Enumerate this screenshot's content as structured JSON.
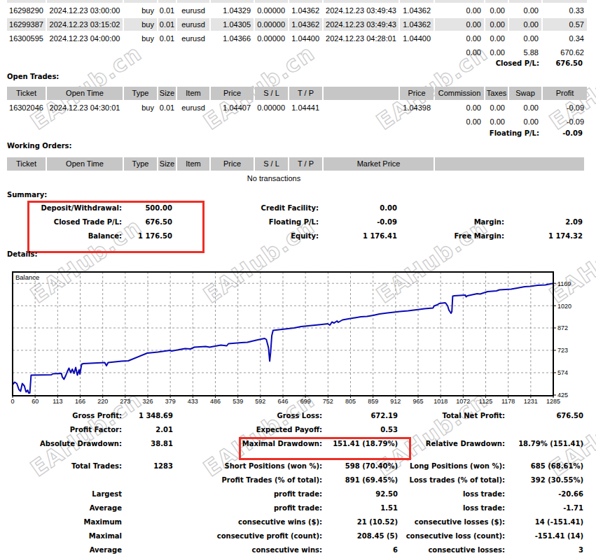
{
  "watermark": {
    "text": "EAHub.cn",
    "color": "#cccccc"
  },
  "colors": {
    "annotation_red": "#ee2e26",
    "curve_blue": "#0a0ab4",
    "table_header_bg": "#c6c6c6",
    "table_alt_row_bg": "#e4e4e4",
    "grid_gray": "#9a9a9a"
  },
  "closed_trades": {
    "rows": [
      [
        "16298290",
        "2024.12.23 03:00:00",
        "buy",
        "0.01",
        "eurusd",
        "1.04329",
        "0.00000",
        "1.04362",
        "2024.12.23 03:49:43",
        "1.04362",
        "0.00",
        "0.00",
        "0.00",
        "0.33"
      ],
      [
        "16299387",
        "2024.12.23 03:15:02",
        "buy",
        "0.01",
        "eurusd",
        "1.04305",
        "0.00000",
        "1.04362",
        "2024.12.23 03:49:43",
        "1.04362",
        "0.00",
        "0.00",
        "0.00",
        "0.57"
      ],
      [
        "16300595",
        "2024.12.23 04:00:00",
        "buy",
        "0.01",
        "eurusd",
        "1.04366",
        "0.00000",
        "1.04400",
        "2024.12.23 04:28:01",
        "1.04400",
        "0.00",
        "0.00",
        "0.00",
        "0.34"
      ]
    ],
    "totals": [
      "0.00",
      "0.00",
      "5.88",
      "670.62"
    ],
    "closed_pl_label": "Closed P/L:",
    "closed_pl_value": "676.50"
  },
  "open_trades": {
    "title": "Open Trades:",
    "columns": [
      "Ticket",
      "Open Time",
      "Type",
      "Size",
      "Item",
      "Price",
      "S / L",
      "T / P",
      "",
      "Price",
      "Commission",
      "Taxes",
      "Swap",
      "Profit"
    ],
    "row": [
      "16302046",
      "2024.12.23 04:30:01",
      "buy",
      "0.01",
      "eurusd",
      "1.04407",
      "0.00000",
      "1.04441",
      "",
      "1.04398",
      "0.00",
      "0.00",
      "0.00",
      "-0.09"
    ],
    "totals": [
      "0.00",
      "0.00",
      "0.00",
      "-0.09"
    ],
    "floating_pl_label": "Floating P/L:",
    "floating_pl_value": "-0.09"
  },
  "working_orders": {
    "title": "Working Orders:",
    "columns": [
      "Ticket",
      "Open Time",
      "Type",
      "Size",
      "Item",
      "Price",
      "S / L",
      "T / P",
      "Market Price"
    ],
    "empty_text": "No transactions"
  },
  "summary": {
    "title": "Summary:",
    "rows": [
      {
        "c1l": "Deposit/Withdrawal:",
        "c1v": "500.00",
        "c2l": "Credit Facility:",
        "c2v": "0.00",
        "c3l": "",
        "c3v": ""
      },
      {
        "c1l": "Closed Trade P/L:",
        "c1v": "676.50",
        "c2l": "Floating P/L:",
        "c2v": "-0.09",
        "c3l": "Margin:",
        "c3v": "2.09"
      },
      {
        "c1l": "Balance:",
        "c1v": "1 176.50",
        "c2l": "Equity:",
        "c2v": "1 176.41",
        "c3l": "Free Margin:",
        "c3v": "1 174.32"
      }
    ]
  },
  "details": {
    "title": "Details:",
    "rows": [
      {
        "c1l": "Gross Profit:",
        "c1v": "1 348.69",
        "c2l": "Gross Loss:",
        "c2v": "672.19",
        "c3l": "Total Net Profit:",
        "c3v": "676.50"
      },
      {
        "c1l": "Profit Factor:",
        "c1v": "2.01",
        "c2l": "Expected Payoff:",
        "c2v": "0.53",
        "c3l": "",
        "c3v": ""
      },
      {
        "c1l": "Absolute Drawdown:",
        "c1v": "38.81",
        "c2l": "Maximal Drawdown:",
        "c2v": "151.41 (18.79%)",
        "c3l": "Relative Drawdown:",
        "c3v": "18.79% (151.41)"
      },
      {
        "c1l": "Total Trades:",
        "c1v": "1283",
        "c2l": "Short Positions (won %):",
        "c2v": "598 (70.40%)",
        "c3l": "Long Positions (won %):",
        "c3v": "685 (68.61%)"
      },
      {
        "c1l": "",
        "c1v": "",
        "c2l": "Profit Trades (% of total):",
        "c2v": "891 (69.45%)",
        "c3l": "Loss trades (% of total):",
        "c3v": "392 (30.55%)"
      },
      {
        "c1l": "Largest",
        "c1v": "",
        "c2l": "profit trade:",
        "c2v": "92.50",
        "c3l": "loss trade:",
        "c3v": "-20.66"
      },
      {
        "c1l": "Average",
        "c1v": "",
        "c2l": "profit trade:",
        "c2v": "1.51",
        "c3l": "loss trade:",
        "c3v": "-1.71"
      },
      {
        "c1l": "Maximum",
        "c1v": "",
        "c2l": "consecutive wins ($):",
        "c2v": "21 (10.52)",
        "c3l": "consecutive losses ($):",
        "c3v": "14 (-151.41)"
      },
      {
        "c1l": "Maximal",
        "c1v": "",
        "c2l": "consecutive profit (count):",
        "c2v": "208.45 (5)",
        "c3l": "consecutive loss (count):",
        "c3v": "-151.41 (14)"
      },
      {
        "c1l": "Average",
        "c1v": "",
        "c2l": "consecutive wins:",
        "c2v": "6",
        "c3l": "consecutive losses:",
        "c3v": "3"
      }
    ]
  },
  "chart_data": {
    "type": "line",
    "title": "Balance",
    "x_tick_labels": [
      "0",
      "60",
      "113",
      "166",
      "220",
      "273",
      "326",
      "379",
      "433",
      "486",
      "539",
      "592",
      "646",
      "699",
      "752",
      "805",
      "859",
      "912",
      "965",
      "1018",
      "1072",
      "1125",
      "1178",
      "1231",
      "1285"
    ],
    "y_tick_labels": [
      "1169",
      "1020",
      "872",
      "723",
      "574",
      "425"
    ],
    "y_tick_values": [
      1169,
      1020,
      872,
      723,
      574,
      425
    ],
    "x_range": [
      0,
      1285
    ],
    "y_range": [
      420.3,
      1244.5
    ],
    "grid": true,
    "series": [
      {
        "name": "Balance",
        "points": [
          [
            0,
            494.8
          ],
          [
            5,
            511.1
          ],
          [
            10,
            501.8
          ],
          [
            15,
            462.2
          ],
          [
            19,
            450.6
          ],
          [
            23,
            501.8
          ],
          [
            28,
            485.5
          ],
          [
            32,
            445.9
          ],
          [
            36,
            457.6
          ],
          [
            38,
            438.9
          ],
          [
            41,
            438.9
          ],
          [
            44,
            557.7
          ],
          [
            92,
            560.0
          ],
          [
            96,
            567.0
          ],
          [
            116,
            569.3
          ],
          [
            118,
            546.0
          ],
          [
            122,
            529.7
          ],
          [
            126,
            553.0
          ],
          [
            130,
            580.9
          ],
          [
            134,
            604.2
          ],
          [
            138,
            574.0
          ],
          [
            142,
            597.2
          ],
          [
            146,
            569.3
          ],
          [
            150,
            608.9
          ],
          [
            154,
            557.7
          ],
          [
            158,
            592.6
          ],
          [
            160,
            564.6
          ],
          [
            164,
            629.8
          ],
          [
            168,
            634.5
          ],
          [
            219,
            641.5
          ],
          [
            223,
            620.5
          ],
          [
            227,
            641.5
          ],
          [
            259,
            650.8
          ],
          [
            275,
            653.1
          ],
          [
            320,
            704.3
          ],
          [
            345,
            711.3
          ],
          [
            374,
            723.0
          ],
          [
            378,
            718.3
          ],
          [
            410,
            734.6
          ],
          [
            423,
            732.3
          ],
          [
            432,
            743.9
          ],
          [
            459,
            748.6
          ],
          [
            468,
            743.9
          ],
          [
            495,
            757.9
          ],
          [
            509,
            753.2
          ],
          [
            513,
            767.2
          ],
          [
            544,
            774.2
          ],
          [
            558,
            776.5
          ],
          [
            572,
            785.8
          ],
          [
            590,
            797.5
          ],
          [
            599,
            802.1
          ],
          [
            603,
            795.1
          ],
          [
            608,
            741.6
          ],
          [
            611,
            650.8
          ],
          [
            613,
            704.3
          ],
          [
            616,
            820.7
          ],
          [
            619,
            855.7
          ],
          [
            669,
            872.0
          ],
          [
            686,
            881.3
          ],
          [
            735,
            895.2
          ],
          [
            749,
            899.9
          ],
          [
            754,
            890.6
          ],
          [
            759,
            911.5
          ],
          [
            764,
            904.5
          ],
          [
            771,
            918.5
          ],
          [
            774,
            909.2
          ],
          [
            784,
            925.5
          ],
          [
            798,
            932.5
          ],
          [
            813,
            939.5
          ],
          [
            828,
            946.5
          ],
          [
            842,
            948.8
          ],
          [
            857,
            955.8
          ],
          [
            872,
            965.1
          ],
          [
            891,
            972.1
          ],
          [
            906,
            976.7
          ],
          [
            920,
            981.4
          ],
          [
            940,
            986.0
          ],
          [
            960,
            993.0
          ],
          [
            979,
            1000.0
          ],
          [
            999,
            1004.7
          ],
          [
            1002,
            1018.6
          ],
          [
            1009,
            1025.6
          ],
          [
            1014,
            1034.9
          ],
          [
            1028,
            1039.6
          ],
          [
            1030,
            1034.9
          ],
          [
            1034,
            1018.6
          ],
          [
            1037,
            990.7
          ],
          [
            1041,
            974.4
          ],
          [
            1042,
            969.7
          ],
          [
            1044,
            981.4
          ],
          [
            1046,
            1083.8
          ],
          [
            1050,
            1086.1
          ],
          [
            1076,
            1090.8
          ],
          [
            1078,
            1079.2
          ],
          [
            1081,
            1086.1
          ],
          [
            1104,
            1100.1
          ],
          [
            1111,
            1097.8
          ],
          [
            1129,
            1114.1
          ],
          [
            1150,
            1118.7
          ],
          [
            1157,
            1125.7
          ],
          [
            1185,
            1130.4
          ],
          [
            1199,
            1137.4
          ],
          [
            1217,
            1146.7
          ],
          [
            1231,
            1149.0
          ],
          [
            1248,
            1156.0
          ],
          [
            1266,
            1158.3
          ],
          [
            1280,
            1166.2
          ],
          [
            1285,
            1167.6
          ]
        ]
      }
    ]
  }
}
